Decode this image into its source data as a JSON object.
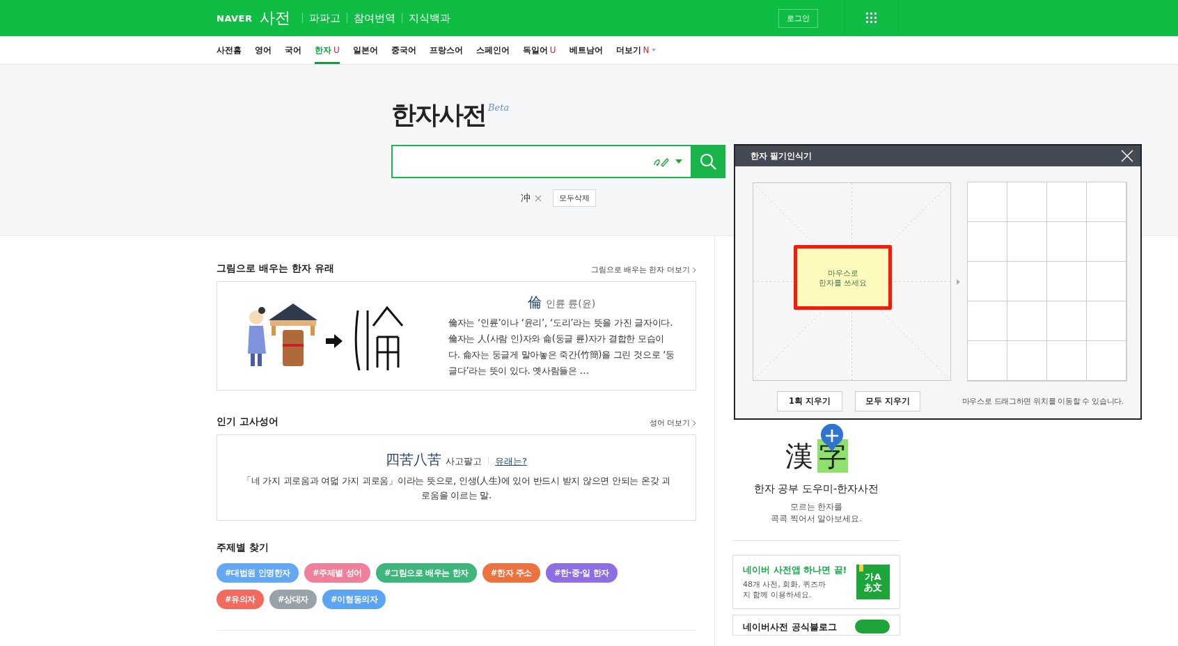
{
  "header": {
    "logo": "NAVER",
    "service": "사전",
    "links": [
      "파파고",
      "참여번역",
      "지식백과"
    ],
    "login": "로그인"
  },
  "nav": [
    {
      "label": "사전홈",
      "selected": false
    },
    {
      "label": "영어",
      "selected": false
    },
    {
      "label": "국어",
      "selected": false
    },
    {
      "label": "한자",
      "selected": true,
      "badge": "U"
    },
    {
      "label": "일본어",
      "selected": false
    },
    {
      "label": "중국어",
      "selected": false
    },
    {
      "label": "프랑스어",
      "selected": false
    },
    {
      "label": "스페인어",
      "selected": false
    },
    {
      "label": "독일어",
      "selected": false,
      "badge": "U"
    },
    {
      "label": "베트남어",
      "selected": false
    },
    {
      "label": "더보기",
      "selected": false,
      "badge": "N",
      "dropdown": true
    }
  ],
  "hero": {
    "title": "한자사전",
    "beta": "Beta",
    "recent": [
      "冲"
    ],
    "clear_all": "모두삭제"
  },
  "origin": {
    "heading": "그림으로 배우는 한자 유래",
    "more": "그림으로 배우는 한자 더보기",
    "hanja": "倫",
    "reading": "인륜 륜(윤)",
    "text": "倫자는 ‘인륜’이나 ‘윤리’, ‘도리’라는 뜻을 가진 글자이다. 倫자는 人(사람 인)자와 侖(둥글 륜)자가 결합한 모습이다. 侖자는 둥글게 말아놓은 죽간(竹簡)을 그린 것으로 ‘둥글다’라는 뜻이 있다. 옛사람들은 …"
  },
  "idiom": {
    "heading": "인기 고사성어",
    "more": "성어 더보기",
    "hanja": "四苦八苦",
    "reading": "사고팔고",
    "link": "유래는?",
    "meaning": "「네 가지 괴로움과 여덟 가지 괴로움」이라는 뜻으로, 인생(人生)에 있어 반드시 받지 않으면 안되는 온갖 괴로움을 이르는 말."
  },
  "topics": {
    "heading": "주제별 찾기",
    "tags": [
      {
        "label": "#대법원 인명한자",
        "color": "#62a8f5"
      },
      {
        "label": "#주제별 성어",
        "color": "#ef7f9b"
      },
      {
        "label": "#그림으로 배우는 한자",
        "color": "#3cb67b"
      },
      {
        "label": "#한자 주소",
        "color": "#ec7240"
      },
      {
        "label": "#한·중·일 한자",
        "color": "#8d6ee3"
      },
      {
        "label": "#유의자",
        "color": "#f26a5e"
      },
      {
        "label": "#상대자",
        "color": "#97a2ab"
      },
      {
        "label": "#이형동의자",
        "color": "#5aa4f3"
      }
    ]
  },
  "promo": {
    "logo_chars": [
      "漢",
      "字"
    ],
    "title": "한자 공부 도우미-한자사전",
    "desc": [
      "모르는 한자를",
      "콕콕 찍어서 알아보세요."
    ]
  },
  "app_card": {
    "title": "네이버 사전앱 하나면 끝!",
    "desc": "48개 사전, 회화, 퀴즈까지 함께 이용하세요.",
    "icon_lines": [
      "가A",
      "あ文"
    ]
  },
  "blog_card": {
    "title": "네이버사전 공식블로그"
  },
  "popup": {
    "title": "한자 필기인식기",
    "hint": [
      "마우스로",
      "한자를 쓰세요"
    ],
    "buttons": [
      "1획 지우기",
      "모두 지우기"
    ],
    "note": "마우스로 드래그하면 위치를 이동할 수 있습니다."
  }
}
